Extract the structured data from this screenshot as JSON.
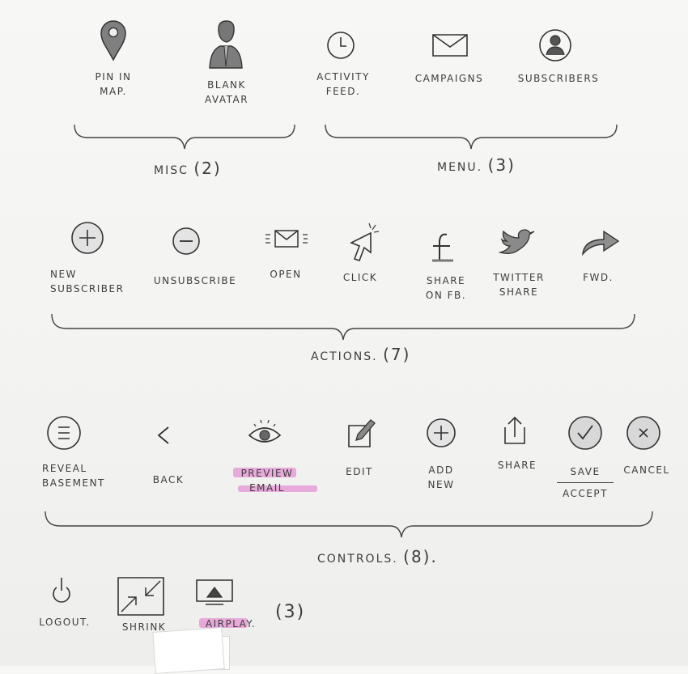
{
  "groups": {
    "misc": {
      "name": "Misc",
      "count": "(2)"
    },
    "menu": {
      "name": "Menu.",
      "count": "(3)"
    },
    "actions": {
      "name": "Actions.",
      "count": "(7)"
    },
    "controls": {
      "name": "Controls.",
      "count": "(8)."
    },
    "extra": {
      "count": "(3)"
    }
  },
  "misc": [
    {
      "l1": "Pin in",
      "l2": "map."
    },
    {
      "l1": "Blank",
      "l2": "avatar"
    }
  ],
  "menu": [
    {
      "l1": "Activity",
      "l2": "feed."
    },
    {
      "l1": "Campaigns"
    },
    {
      "l1": "Subscribers"
    }
  ],
  "actions": [
    {
      "l1": "New",
      "l2": "subscriber"
    },
    {
      "l1": "Unsubscribe"
    },
    {
      "l1": "Open"
    },
    {
      "l1": "Click"
    },
    {
      "l1": "Share",
      "l2": "on FB."
    },
    {
      "l1": "Twitter",
      "l2": "share"
    },
    {
      "l1": "Fwd."
    }
  ],
  "controls": [
    {
      "l1": "Reveal",
      "l2": "basement"
    },
    {
      "l1": "Back"
    },
    {
      "l1": "Preview",
      "l2": "email"
    },
    {
      "l1": "Edit"
    },
    {
      "l1": "Add",
      "l2": "new"
    },
    {
      "l1": "Share"
    },
    {
      "l1": "Save",
      "l2": "accept"
    },
    {
      "l1": "Cancel"
    }
  ],
  "extra": [
    {
      "l1": "Logout."
    },
    {
      "l1": "Shrink"
    },
    {
      "l1": "Airplay."
    }
  ],
  "highlight_color": "#e070c8"
}
